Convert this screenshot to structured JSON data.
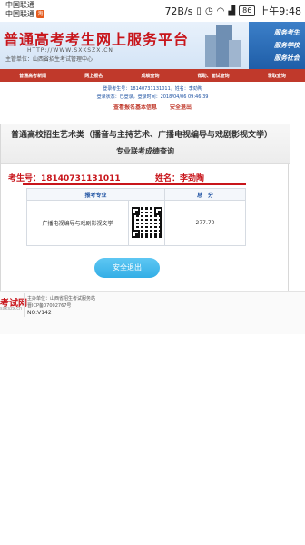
{
  "status_bar": {
    "carrier_1": "中国联通",
    "carrier_2": "中国联通",
    "carrier_badge": "淘",
    "speed": "72B/s",
    "battery": "86",
    "time": "上午9:48",
    "icons": [
      "vibrate-icon",
      "alarm-icon",
      "wifi-icon",
      "signal-icon"
    ]
  },
  "banner": {
    "title": "普通高考考生网上服务平台",
    "url": "HTTP://WWW.SXKSZX.CN",
    "host": "主管单位：山西省招生考试管理中心",
    "services": [
      "服务考生",
      "服务学校",
      "服务社会"
    ]
  },
  "nav": {
    "items": [
      "普通高考新闻",
      "网上报名",
      "成绩查询",
      "帮助、面试查询",
      "录取查询"
    ]
  },
  "account": {
    "line1": "登录考生号：18140731131011，姓名：李劲陶",
    "line2": "登录状态：已登录，登录时间：2018/04/06 09:46:39",
    "link_view": "查看报名基本信息",
    "link_logout": "安全退出"
  },
  "panel": {
    "title_line1": "普通高校招生艺术类（播音与主持艺术、广播电视编导与戏剧影视文学）",
    "title_line2": "专业联考成绩查询",
    "candidate_label": "考生号：18140731131011",
    "name_label": "姓名：李劲陶",
    "table": {
      "headers": [
        "报考专业",
        "总　分"
      ],
      "rows": [
        {
          "major": "广播电视编导与戏剧影视文学",
          "score": "277.70"
        }
      ]
    },
    "logout_button": "安全退出"
  },
  "footer": {
    "logo": "考试网",
    "logo_sub": "sxkszx.cn",
    "sponsor": "主办单位：山西省招生考试服务站",
    "icp": "晋ICP备07002767号",
    "no": "NO:V142"
  },
  "colors": {
    "brand_red": "#c8151b",
    "nav_red": "#c0392b",
    "link_blue": "#1a4fa0",
    "button_blue": "#33aee6"
  }
}
